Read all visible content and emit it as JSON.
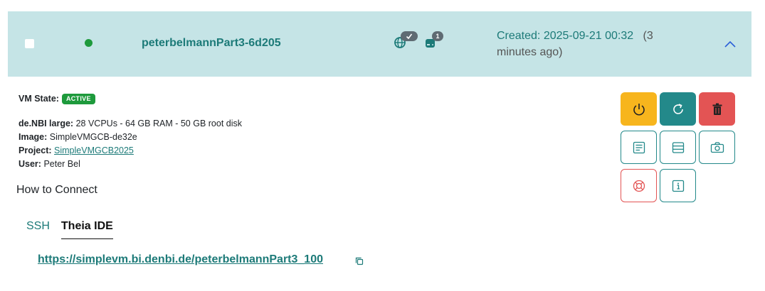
{
  "vm": {
    "name": "peterbelmannPart3-6d205",
    "volume_count": "1",
    "created_label": "Created: 2025-09-21 00:32",
    "created_ago": "(3 minutes ago)"
  },
  "details": {
    "state_label": "VM State:",
    "state_value": "ACTIVE",
    "flavor_label": "de.NBI large:",
    "flavor_value": "28 VCPUs - 64 GB RAM - 50 GB root disk",
    "image_label": "Image:",
    "image_value": "SimpleVMGCB-de32e",
    "project_label": "Project:",
    "project_value": "SimpleVMGCB2025",
    "user_label": "User:",
    "user_value": "Peter Bel"
  },
  "connect": {
    "heading": "How to Connect",
    "tabs": [
      {
        "label": "SSH"
      },
      {
        "label": "Theia IDE"
      }
    ],
    "ide_url": "https://simplevm.bi.denbi.de/peterbelmannPart3_100"
  },
  "colors": {
    "header_bg": "#c5e4e6",
    "accent": "#1c7a78",
    "active_green": "#1e9a3c",
    "warning": "#f7b51d",
    "danger": "#e35454"
  },
  "icons": {
    "actions": [
      "power-icon",
      "restart-icon",
      "trash-icon",
      "log-icon",
      "server-icon",
      "camera-icon",
      "lifebuoy-icon",
      "info-icon"
    ]
  }
}
